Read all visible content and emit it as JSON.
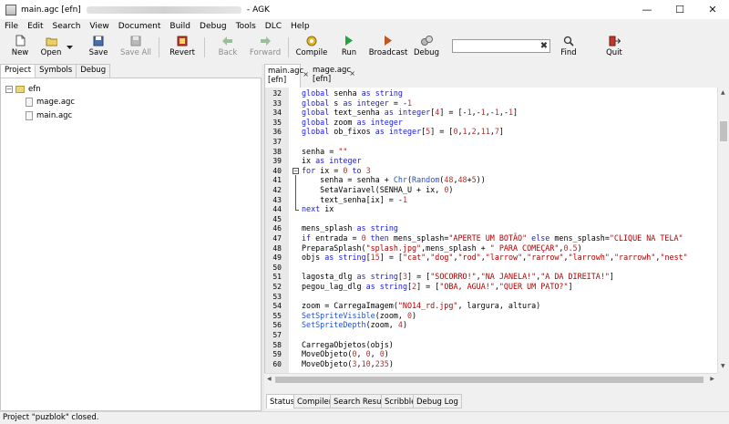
{
  "titlebar": {
    "file": "main.agc [efn]",
    "app": "AGK"
  },
  "menu": [
    "File",
    "Edit",
    "Search",
    "View",
    "Document",
    "Build",
    "Debug",
    "Tools",
    "DLC",
    "Help"
  ],
  "toolbar": {
    "new": "New",
    "open": "Open",
    "save": "Save",
    "save_all": "Save All",
    "revert": "Revert",
    "back": "Back",
    "forward": "Forward",
    "compile": "Compile",
    "run": "Run",
    "broadcast": "Broadcast",
    "debug": "Debug",
    "find": "Find",
    "quit": "Quit",
    "search_value": ""
  },
  "left_tabs": [
    "Project",
    "Symbols",
    "Debug"
  ],
  "tree": {
    "root": "efn",
    "files": [
      "mage.agc",
      "main.agc"
    ]
  },
  "editor_tabs": [
    {
      "line1": "main.agc",
      "line2": "[efn]"
    },
    {
      "line1": "mage.agc",
      "line2": "[efn]"
    }
  ],
  "line_numbers": [
    "32",
    "33",
    "34",
    "35",
    "36",
    "37",
    "38",
    "39",
    "40",
    "41",
    "42",
    "43",
    "44",
    "45",
    "46",
    "47",
    "48",
    "49",
    "50",
    "51",
    "52",
    "53",
    "54",
    "55",
    "56",
    "57",
    "58",
    "59",
    "60"
  ],
  "code_lines": [
    "global senha as string",
    "global s as integer = -1",
    "global text_senha as integer[4] = [-1,-1,-1,-1]",
    "global zoom as integer",
    "global ob_fixos as integer[5] = [0,1,2,11,7]",
    "",
    "senha = \"\"",
    "ix as integer",
    "for ix = 0 to 3",
    "    senha = senha + Chr(Random(48,48+5))",
    "    SetaVariavel(SENHA_U + ix, 0)",
    "    text_senha[ix] = -1",
    "next ix",
    "",
    "mens_splash as string",
    "if entrada = 0 then mens_splash=\"APERTE UM BOTÃO\" else mens_splash=\"CLIQUE NA TELA\"",
    "PreparaSplash(\"splash.jpg\",mens_splash + \" PARA COMEÇAR\",0.5)",
    "objs as string[15] = [\"cat\",\"dog\",\"rod\",\"larrow\",\"rarrow\",\"larrowh\",\"rarrowh\",\"nest\"",
    "",
    "lagosta_dlg as string[3] = [\"SOCORRO!\",\"NA JANELA!\",\"A DA DIREITA!\"]",
    "pegou_lag_dlg as string[2] = [\"OBA, AGUA!\",\"QUER UM PATO?\"]",
    "",
    "zoom = CarregaImagem(\"NO14_rd.jpg\", largura, altura)",
    "SetSpriteVisible(zoom, 0)",
    "SetSpriteDepth(zoom, 4)",
    "",
    "CarregaObjetos(objs)",
    "MoveObjeto(0, 0, 0)",
    "MoveObjeto(3,10,235)"
  ],
  "bottom_tabs": [
    "Status",
    "Compiler",
    "Search Results",
    "Scribble",
    "Debug Log"
  ],
  "status": "Project \"puzblok\" closed.",
  "colors": {
    "keyword": "#1a1ad8",
    "string": "#b00000",
    "number": "#b03030",
    "function": "#2050d0"
  },
  "icons": {
    "new": "new-file-icon",
    "open": "open-folder-icon",
    "save": "save-icon",
    "save_all": "save-all-icon",
    "revert": "revert-icon",
    "back": "back-arrow-icon",
    "forward": "forward-arrow-icon",
    "compile": "compile-gear-icon",
    "run": "run-icon",
    "broadcast": "broadcast-icon",
    "debug": "debug-icon",
    "find": "find-icon",
    "quit": "quit-icon"
  }
}
